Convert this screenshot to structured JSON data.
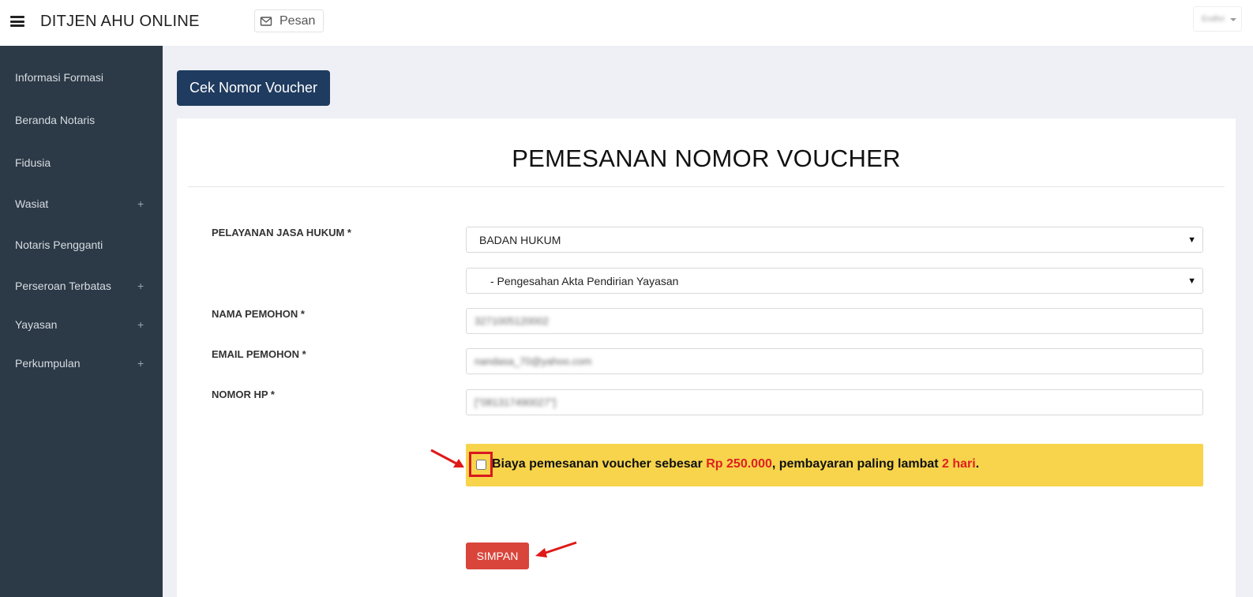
{
  "header": {
    "brand": "DITJEN AHU ONLINE",
    "pesan_label": "Pesan",
    "user_name": "Endhri"
  },
  "sidebar": {
    "items": [
      {
        "label": "Informasi Formasi",
        "expandable": false
      },
      {
        "label": "Beranda Notaris",
        "expandable": false
      },
      {
        "label": "Fidusia",
        "expandable": false
      },
      {
        "label": "Wasiat",
        "expandable": true
      },
      {
        "label": "Notaris Pengganti",
        "expandable": false
      },
      {
        "label": "Perseroan Terbatas",
        "expandable": true
      },
      {
        "label": "Yayasan",
        "expandable": true
      },
      {
        "label": "Perkumpulan",
        "expandable": true
      }
    ],
    "expand_symbol": "+"
  },
  "main": {
    "cek_button": "Cek Nomor Voucher",
    "title": "PEMESANAN NOMOR VOUCHER",
    "form": {
      "pelayanan_label": "PELAYANAN JASA HUKUM *",
      "pelayanan_value": "BADAN HUKUM",
      "sub_layanan_value": "- Pengesahan Akta Pendirian Yayasan",
      "nama_label": "NAMA PEMOHON *",
      "nama_value": "3271005120002",
      "email_label": "EMAIL PEMOHON *",
      "email_value": "nandasa_70@yahoo.com",
      "hp_label": "NOMOR HP *",
      "hp_value": "[\"081317490027\"]"
    },
    "notice": {
      "text_1": "Biaya pemesanan voucher sebesar ",
      "amount": "Rp 250.000",
      "text_2": ", pembayaran paling lambat ",
      "deadline": "2 hari",
      "text_3": ".",
      "checked": false
    },
    "save_button": "SIMPAN"
  },
  "colors": {
    "sidebar_bg": "#2c3946",
    "content_bg": "#eef0f5",
    "cek_button_bg": "#1f3b5f",
    "notice_bg": "#f7d44c",
    "save_button_bg": "#d9453b",
    "highlight_red": "#d9181e"
  }
}
